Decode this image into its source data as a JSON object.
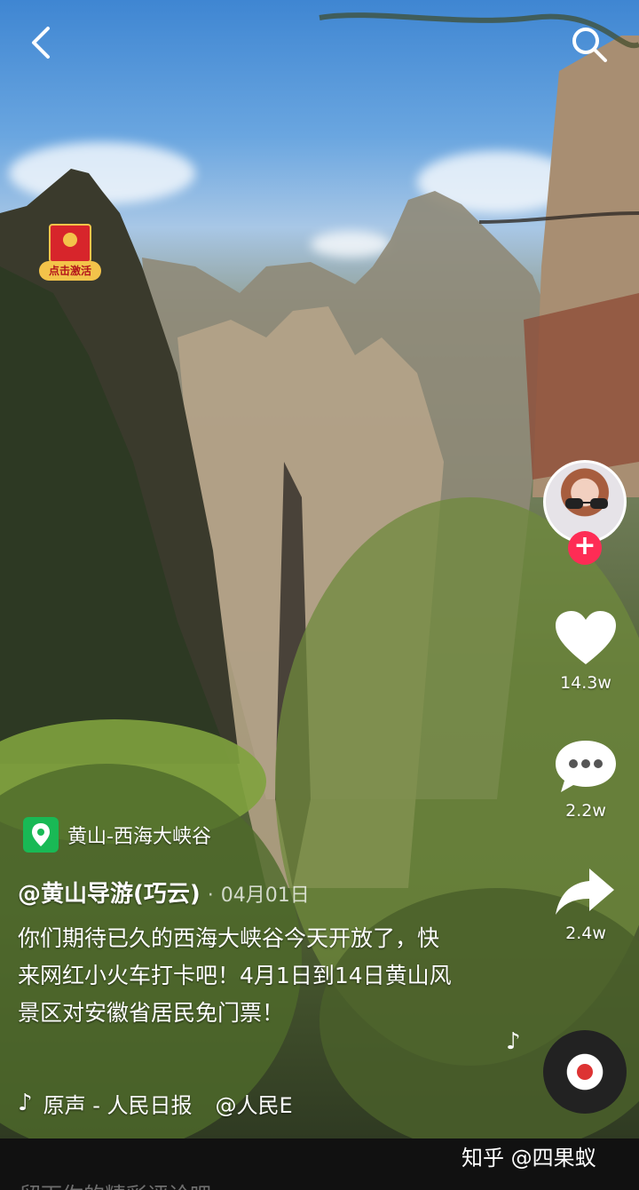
{
  "location": {
    "name": "黄山-西海大峡谷"
  },
  "post": {
    "author": "@黄山导游(巧云)",
    "separator": "·",
    "date": "04月01日",
    "caption": "你们期待已久的西海大峡谷今天开放了，快来网红小火车打卡吧！4月1日到14日黄山风景区对安徽省居民免门票！"
  },
  "music": {
    "title": "原声 - 人民日报",
    "mention": "@人民E"
  },
  "actions": {
    "like_count": "14.3w",
    "comment_count": "2.2w",
    "share_count": "2.4w"
  },
  "redpacket": {
    "label": "点击激活"
  },
  "follow": {
    "symbol": "+"
  },
  "watermark": "知乎 @四果蚁",
  "comment_hint": "留下你的精彩评论吧",
  "icons": {
    "back": "chevron-left-icon",
    "search": "search-icon",
    "location": "location-pin-icon",
    "like": "heart-icon",
    "comment": "comment-bubble-icon",
    "share": "share-arrow-icon",
    "music": "tiktok-note-icon"
  },
  "colors": {
    "follow": "#fe2c55",
    "location_pin": "#19b955",
    "redpacket": "#d7252b"
  }
}
